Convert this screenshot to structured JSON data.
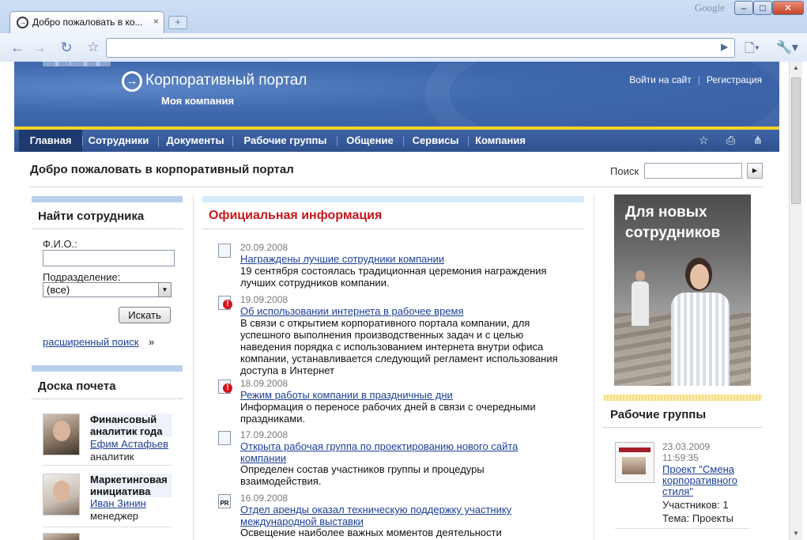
{
  "browser": {
    "tab_title": "Добро пожаловать в ко...",
    "tab_close": "×",
    "new_tab": "+",
    "brand": "Google",
    "minimize": "–",
    "maximize": "□",
    "close": "✕",
    "url": ""
  },
  "site": {
    "logo_title": "Корпоративный портал",
    "logo_subtitle": "Моя компания",
    "login": "Войти на сайт",
    "register": "Регистрация"
  },
  "menu": [
    {
      "label": "Главная",
      "active": true
    },
    {
      "label": "Сотрудники"
    },
    {
      "label": "Документы"
    },
    {
      "label": "Рабочие группы"
    },
    {
      "label": "Общение"
    },
    {
      "label": "Сервисы"
    },
    {
      "label": "Компания"
    }
  ],
  "page": {
    "welcome": "Добро пожаловать в корпоративный портал",
    "search_label": "Поиск"
  },
  "find_employee": {
    "title": "Найти сотрудника",
    "fio_label": "Ф.И.О.:",
    "dept_label": "Подразделение:",
    "dept_value": "(все)",
    "search_button": "Искать",
    "advanced_link": "расширенный поиск",
    "advanced_suffix": "»"
  },
  "honor_board": {
    "title": "Доска почета",
    "items": [
      {
        "title": "Финансовый аналитик года",
        "name": "Ефим Астафьев",
        "role": "аналитик"
      },
      {
        "title": "Маркетинговая инициатива",
        "name": "Иван Зинин",
        "role": "менеджер"
      }
    ]
  },
  "official": {
    "title": "Официальная информация",
    "news": [
      {
        "icon": "newspaper-icon",
        "date": "20.09.2008",
        "title": "Награждены лучшие сотрудники компании",
        "text": "19 сентября состоялась традиционная церемония награждения лучших сотрудников компании."
      },
      {
        "icon": "alert-icon",
        "date": "19.09.2008",
        "title": "Об использовании интернета в рабочее время",
        "text": "В связи с открытием корпоративного портала компании, для успешного выполнения производственных задач и с целью наведения порядка с использованием интернета внутри офиса компании, устанавливается следующий регламент использования доступа в Интернет"
      },
      {
        "icon": "alert-icon",
        "date": "18.09.2008",
        "title": "Режим работы компании в праздничные дни",
        "text": "Информация о переносе рабочих дней в связи с очередными праздниками."
      },
      {
        "icon": "document-icon",
        "date": "17.09.2008",
        "title": "Открыта рабочая группа по проектированию нового сайта компании",
        "text": "Определен состав участников группы и процедуры взаимодействия."
      },
      {
        "icon": "pr-icon",
        "date": "16.09.2008",
        "title": "Отдел аренды оказал техническую поддержку участнику международной выставки",
        "text": "Освещение наиболее важных моментов деятельности"
      }
    ],
    "pr_icon_text": "PR"
  },
  "promo": {
    "line1": "Для новых",
    "line2": "сотрудников"
  },
  "work_groups": {
    "title": "Рабочие группы",
    "items": [
      {
        "date": "23.03.2009",
        "time": "11:59:35",
        "title": "Проект \"Смена корпоративного стиля\"",
        "members": "Участников: 1",
        "topic": "Тема: Проекты"
      }
    ]
  },
  "colors": {
    "header_blue": "#3f68ad",
    "menu_blue": "#2f518f",
    "accent_yellow": "#f5d22a",
    "section_red": "#c4181b",
    "link_blue": "#1c3f94"
  }
}
